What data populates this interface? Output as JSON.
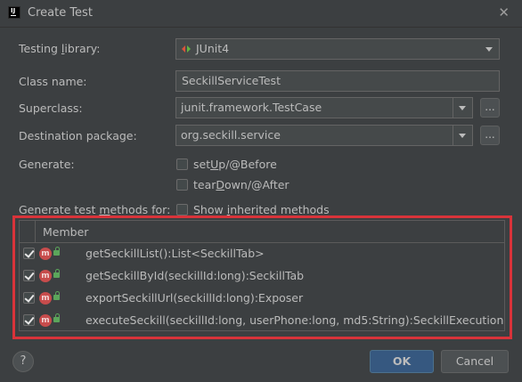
{
  "window": {
    "title": "Create Test",
    "close_glyph": "✕"
  },
  "form": {
    "testing_library": {
      "label": "Testing library:",
      "value": "JUnit4"
    },
    "class_name": {
      "label": "Class name:",
      "value": "SeckillServiceTest"
    },
    "superclass": {
      "label": "Superclass:",
      "value": "junit.framework.TestCase",
      "browse": "..."
    },
    "destination_package": {
      "label": "Destination package:",
      "value": "org.seckill.service",
      "browse": "..."
    },
    "generate": {
      "label": "Generate:",
      "setup": {
        "label": "setUp/@Before",
        "checked": false
      },
      "teardown": {
        "label": "tearDown/@After",
        "checked": false
      }
    },
    "methods_for": {
      "label": "Generate test methods for:",
      "show_inherited": {
        "label": "Show inherited methods",
        "checked": false
      }
    }
  },
  "table": {
    "header": "Member",
    "rows": [
      {
        "checked": true,
        "icon": "m",
        "text": "getSeckillList():List<SeckillTab>"
      },
      {
        "checked": true,
        "icon": "m",
        "text": "getSeckillById(seckillId:long):SeckillTab"
      },
      {
        "checked": true,
        "icon": "m",
        "text": "exportSeckillUrl(seckillId:long):Exposer"
      },
      {
        "checked": true,
        "icon": "m",
        "text": "executeSeckill(seckillId:long, userPhone:long, md5:String):SeckillExecution"
      }
    ]
  },
  "footer": {
    "help": "?",
    "ok": "OK",
    "cancel": "Cancel"
  },
  "colors": {
    "background": "#3c3f41",
    "highlight": "#d9333a",
    "ok_button": "#365880"
  }
}
